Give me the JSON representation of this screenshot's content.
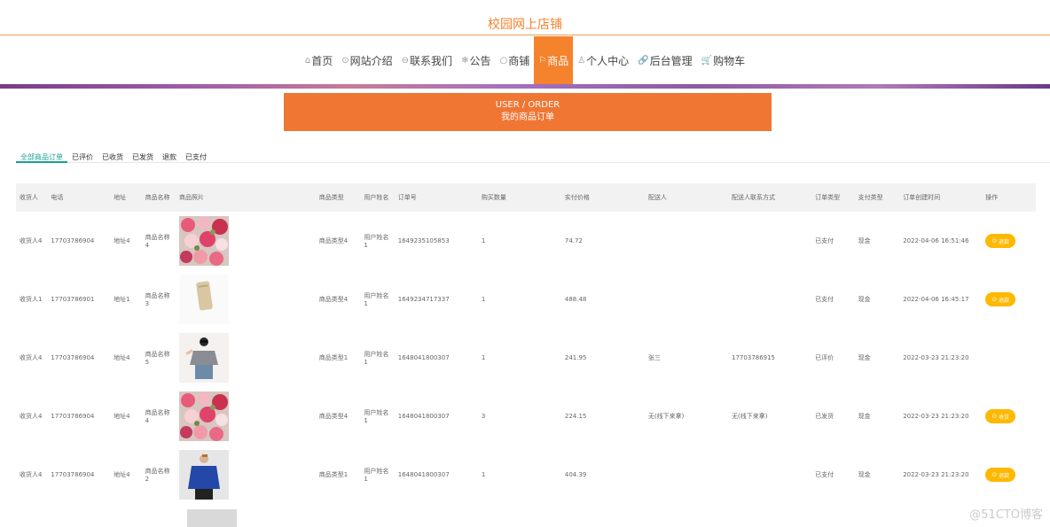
{
  "site": {
    "title": "校园网上店铺"
  },
  "nav": [
    {
      "icon": "⌂",
      "label": "首页",
      "active": false
    },
    {
      "icon": "⊙",
      "label": "网站介绍",
      "active": false
    },
    {
      "icon": "⊖",
      "label": "联系我们",
      "active": false
    },
    {
      "icon": "❄",
      "label": "公告",
      "active": false
    },
    {
      "icon": "○",
      "label": "商铺",
      "active": false
    },
    {
      "icon": "⚐",
      "label": "商品",
      "active": true
    },
    {
      "icon": "♙",
      "label": "个人中心",
      "active": false
    },
    {
      "icon": "🔗",
      "label": "后台管理",
      "active": false
    },
    {
      "icon": "🛒",
      "label": "购物车",
      "active": false
    }
  ],
  "header_box": {
    "line1": "USER / ORDER",
    "line2": "我的商品订单"
  },
  "tabs": [
    "全部商品订单",
    "已评价",
    "已收货",
    "已发货",
    "退款",
    "已支付"
  ],
  "table": {
    "columns": [
      "收货人",
      "电话",
      "地址",
      "商品名称",
      "商品照片",
      "商品类型",
      "用户姓名",
      "订单号",
      "购买数量",
      "实付价格",
      "配送人",
      "配送人联系方式",
      "订单类型",
      "支付类型",
      "订单创建时间",
      "操作"
    ],
    "rows": [
      {
        "receiver": "收货人4",
        "phone": "17703786904",
        "address": "地址4",
        "product": "商品名称4",
        "photo": "flowers",
        "type": "商品类型4",
        "user": "用户姓名1",
        "order_no": "1649235105853",
        "qty": "1",
        "price": "74.72",
        "courier": "",
        "courier_phone": "",
        "status": "已支付",
        "pay": "现金",
        "time": "2022-04-06 16:51:46",
        "action": "退款"
      },
      {
        "receiver": "收货人1",
        "phone": "17703786901",
        "address": "地址1",
        "product": "商品名称3",
        "photo": "phone",
        "type": "商品类型4",
        "user": "用户姓名1",
        "order_no": "1649234717337",
        "qty": "1",
        "price": "488.48",
        "courier": "",
        "courier_phone": "",
        "status": "已支付",
        "pay": "现金",
        "time": "2022-04-06 16:45:17",
        "action": "退款"
      },
      {
        "receiver": "收货人4",
        "phone": "17703786904",
        "address": "地址4",
        "product": "商品名称5",
        "photo": "woman-shirt",
        "type": "商品类型1",
        "user": "用户姓名1",
        "order_no": "1648041800307",
        "qty": "1",
        "price": "241.95",
        "courier": "张三",
        "courier_phone": "17703786915",
        "status": "已评价",
        "pay": "现金",
        "time": "2022-03-23 21:23:20",
        "action": ""
      },
      {
        "receiver": "收货人4",
        "phone": "17703786904",
        "address": "地址4",
        "product": "商品名称4",
        "photo": "flowers",
        "type": "商品类型4",
        "user": "用户姓名1",
        "order_no": "1648041800307",
        "qty": "3",
        "price": "224.15",
        "courier": "无(线下来拿)",
        "courier_phone": "无(线下来拿)",
        "status": "已发货",
        "pay": "现金",
        "time": "2022-03-23 21:23:20",
        "action": "收货"
      },
      {
        "receiver": "收货人4",
        "phone": "17703786904",
        "address": "地址4",
        "product": "商品名称2",
        "photo": "man-sweater",
        "type": "商品类型1",
        "user": "用户姓名1",
        "order_no": "1648041800307",
        "qty": "1",
        "price": "404.39",
        "courier": "",
        "courier_phone": "",
        "status": "已支付",
        "pay": "现金",
        "time": "2022-03-23 21:23:20",
        "action": "退款"
      }
    ]
  },
  "watermark": "@51CTO博客",
  "colors": {
    "accent": "#f5822c",
    "tab_active": "#1aa093",
    "button": "#ffb800"
  }
}
